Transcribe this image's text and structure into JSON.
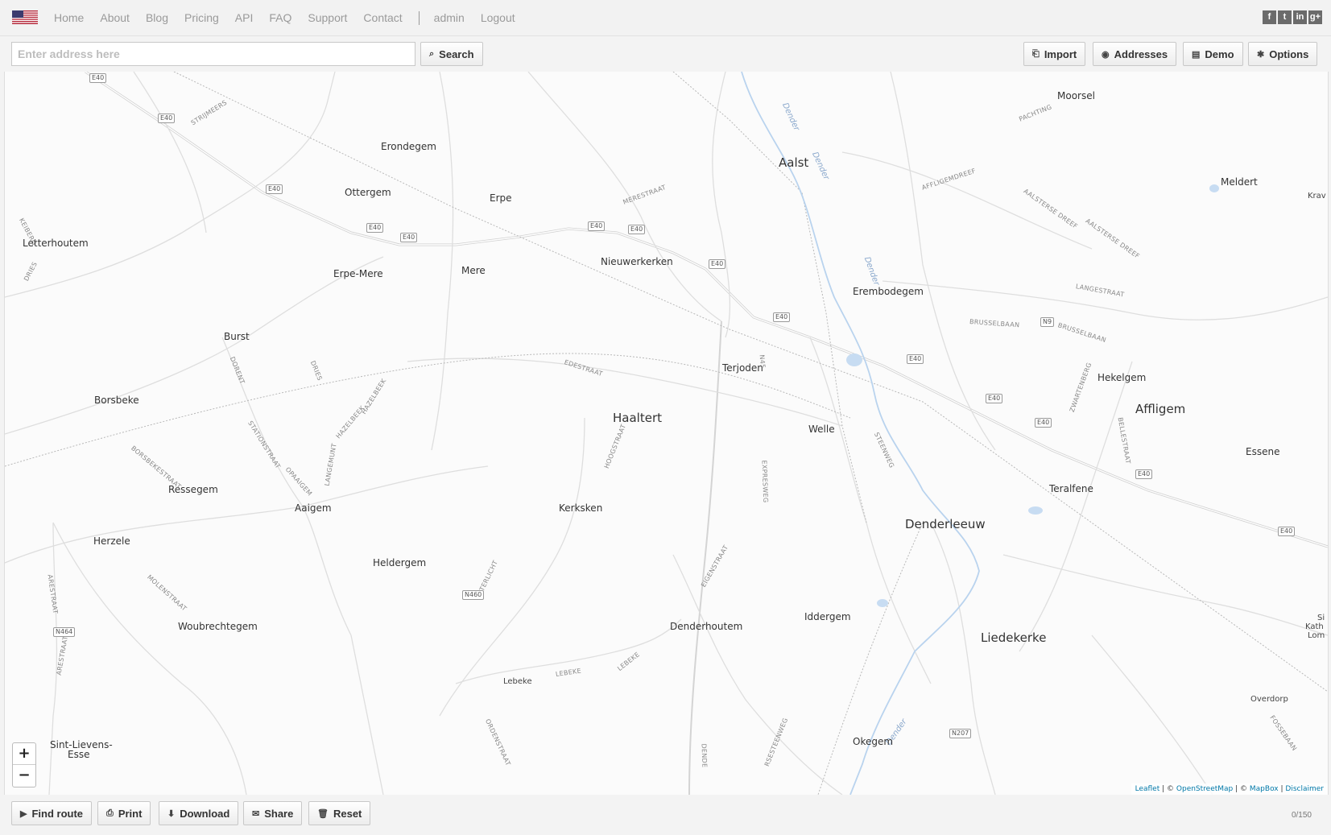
{
  "nav": {
    "links": [
      "Home",
      "About",
      "Blog",
      "Pricing",
      "API",
      "FAQ",
      "Support",
      "Contact"
    ],
    "user_links": [
      "admin",
      "Logout"
    ],
    "social": [
      "f",
      "t",
      "in",
      "g+"
    ]
  },
  "toolbar": {
    "address_placeholder": "Enter address here",
    "search_label": "Search",
    "import_label": "Import",
    "addresses_label": "Addresses",
    "demo_label": "Demo",
    "options_label": "Options"
  },
  "map": {
    "places": {
      "moorsel": "Moorsel",
      "erondegem": "Erondegem",
      "aalst": "Aalst",
      "meldert": "Meldert",
      "krav": "Krav",
      "ottergem": "Ottergem",
      "erpe": "Erpe",
      "letterhoutem": "Letterhoutem",
      "erpe_mere": "Erpe-Mere",
      "mere": "Mere",
      "nieuwerkerken": "Nieuwerkerken",
      "erembodegem": "Erembodegem",
      "burst": "Burst",
      "terjoden": "Terjoden",
      "hekelgem": "Hekelgem",
      "borsbeke": "Borsbeke",
      "haaltert": "Haaltert",
      "welle": "Welle",
      "affligem": "Affligem",
      "essene": "Essene",
      "ressegem": "Ressegem",
      "teralfene": "Teralfene",
      "aaigem": "Aaigem",
      "kerksken": "Kerksken",
      "denderleeuw": "Denderleeuw",
      "herzele": "Herzele",
      "heldergem": "Heldergem",
      "iddergem": "Iddergem",
      "woubrechtegem": "Woubrechtegem",
      "denderhoutem": "Denderhoutem",
      "liedekerke": "Liedekerke",
      "lebeke": "Lebeke",
      "overdorp": "Overdorp",
      "okegem": "Okegem",
      "sint_lievens": "Sint-Lievens-",
      "esse": "Esse",
      "si": "Si",
      "kath": "Kath",
      "lom": "Lom"
    },
    "streets": {
      "strijmeers": "STRIJMEERS",
      "keiberg": "KEIBERG",
      "dries1": "DRIES",
      "merestraat": "MERESTRAAT",
      "pachting": "PACHTING",
      "affligemdreef": "AFFLIGEMDREEF",
      "aalsterse1": "AALSTERSE DREEF",
      "aalsterse2": "AALSTERSE DREEF",
      "langestraat": "LANGESTRAAT",
      "brusselbaan1": "BRUSSELBAAN",
      "brusselbaan2": "BRUSSELBAAN",
      "dorent": "DORENT",
      "dries2": "DRIES",
      "edestraat": "EDESTRAAT",
      "hazelbeek1": "HAZELBEEK",
      "hazelbeek2": "HAZELBEEK",
      "stationstraat": "STATIONSTRAAT",
      "borsbekestraat": "BORSBEKESTRAAT",
      "opaaigem": "OPAAIGEM",
      "langemunt": "LANGEMUNT",
      "hoogstraat": "HOOGSTRAAT",
      "zwartenberg": "ZWARTENBERG",
      "bellestraat": "BELLESTRAAT",
      "steenweg": "STEENWEG",
      "expresweg": "EXPRESWEG",
      "n45": "N45",
      "arestraat1": "ARESTRAAT",
      "arestraat2": "ARESTRAAT",
      "molenstraat": "MOLENSTRAAT",
      "terlicht": "TERLICHT",
      "eigenstraat": "EIGENSTRAAT",
      "lebeke_st1": "LEBEKE",
      "lebeke_st2": "LEBEKE",
      "ordenstraat": "ORDENSTRAAT",
      "dende": "DENDE",
      "rsesteenweg": "RSESTEENWEG",
      "fossebaan": "FOSSEBAAN"
    },
    "shields": {
      "e40_a": "E40",
      "e40_b": "E40",
      "e40_c": "E40",
      "e40_d": "E40",
      "e40_e": "E40",
      "e40_f": "E40",
      "e40_g": "E40",
      "e40_h": "E40",
      "e40_i": "E40",
      "e40_j": "E40",
      "e40_k": "E40",
      "e40_l": "E40",
      "e40_m": "E40",
      "e40_n": "E40",
      "n9": "N9",
      "n460": "N460",
      "n464": "N464",
      "n207": "N207"
    },
    "rivers": {
      "dender1": "Dender",
      "dender2": "Dender",
      "dender3": "Dender",
      "dender4": "Dender"
    },
    "zoom_in": "+",
    "zoom_out": "−",
    "attribution": {
      "leaflet": "Leaflet",
      "sep1": " | © ",
      "osm": "OpenStreetMap",
      "sep2": " | © ",
      "mapbox": "MapBox",
      "sep3": " | ",
      "disclaimer": "Disclaimer"
    }
  },
  "bottombar": {
    "find_route": "Find route",
    "print": "Print",
    "download": "Download",
    "share": "Share",
    "reset": "Reset",
    "counter": "0/150"
  },
  "colors": {
    "road": "#dcdcdc",
    "motorway": "#cfcfcf",
    "water": "#b9d3ee",
    "attribution_link": "#0078a8"
  }
}
